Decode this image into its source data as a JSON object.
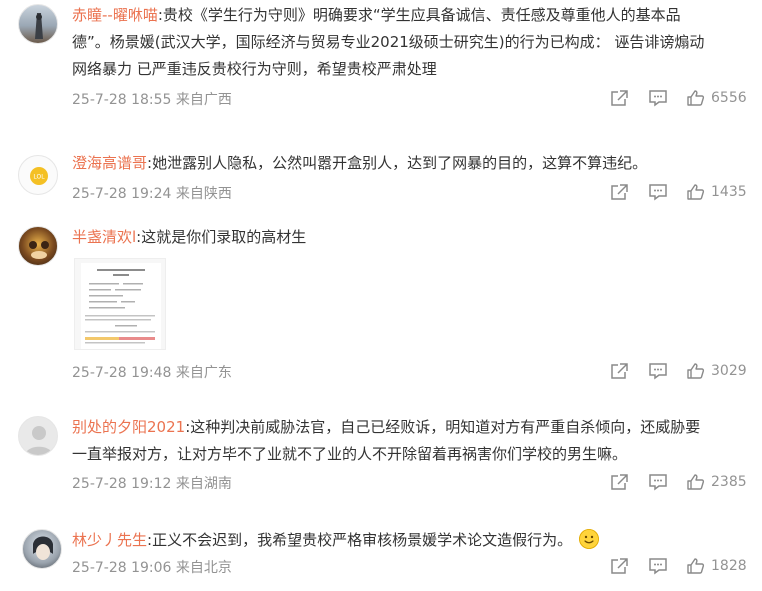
{
  "comments": [
    {
      "username": "赤瞳--曜咻喵",
      "body": ":贵校《学生行为守则》明确要求“学生应具备诚信、责任感及尊重他人的基本品德”。杨景媛(武汉大学，国际经济与贸易专业2021级硕士研究生)的行为已构成： 诬告诽谤煽动网络暴力 已严重违反贵校行为守则，希望贵校严肃处理",
      "line1": ":贵校《学生行为守则》明确要求“学生应具备诚信、责任感及尊重他人的基本品",
      "line2": "德”。杨景媛(武汉大学，国际经济与贸易专业2021级硕士研究生)的行为已构成： 诬告诽谤煽动",
      "line3": "网络暴力 已严重违反贵校行为守则，希望贵校严肃处理",
      "time": "25-7-28 18:55",
      "location": "来自广西",
      "likes": "6556"
    },
    {
      "username": "澄海高谱哥",
      "body": ":她泄露别人隐私，公然叫嚣开盒别人，达到了网暴的目的，这算不算违纪。",
      "time": "25-7-28 19:24",
      "location": "来自陕西",
      "likes": "1435"
    },
    {
      "username": "半盏清欢l",
      "body": ":这就是你们录取的高材生",
      "time": "25-7-28 19:48",
      "location": "来自广东",
      "likes": "3029"
    },
    {
      "username": "别处的夕阳2021",
      "body": ":这种判决前威胁法官，自己已经败诉，明知道对方有严重自杀倾向，还威胁要一直举报对方，让对方毕不了业就不了业的人不开除留着再祸害你们学校的男生嘛。",
      "line1": ":这种判决前威胁法官，自己已经败诉，明知道对方有严重自杀倾向，还威胁要",
      "line2": "一直举报对方，让对方毕不了业就不了业的人不开除留着再祸害你们学校的男生嘛。",
      "time": "25-7-28 19:12",
      "location": "来自湖南",
      "likes": "2385"
    },
    {
      "username": "林少丿先生",
      "body": ":正义不会迟到，我希望贵校严格审核杨景媛学术论文造假行为。",
      "time": "25-7-28 19:06",
      "location": "来自北京",
      "likes": "1828"
    }
  ],
  "icons": {
    "share": "share-icon",
    "comment": "comment-icon",
    "like": "like-icon",
    "emoji": "smile-emoji-icon"
  },
  "colors": {
    "username": "#eb7350",
    "text": "#333333",
    "meta": "#939393"
  }
}
